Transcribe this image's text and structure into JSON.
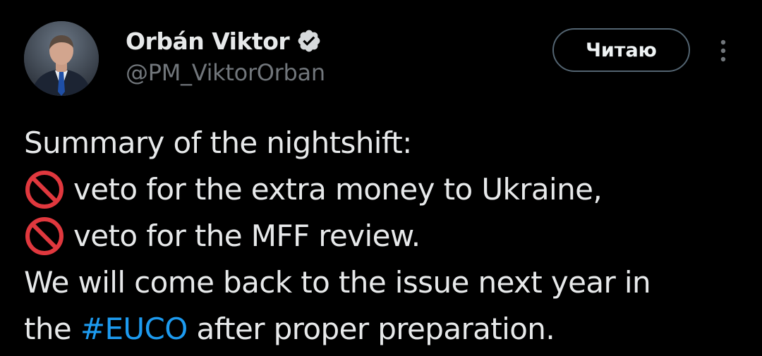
{
  "author": {
    "display_name": "Orbán Viktor",
    "handle": "@PM_ViktorOrban",
    "verified": true
  },
  "follow_button": {
    "label": "Читаю"
  },
  "more_button": {
    "icon": "more-vertical-icon"
  },
  "tweet": {
    "line1": "Summary of the nightshift:",
    "line2": "veto for the extra money to Ukraine,",
    "line3": "veto for the MFF review.",
    "line4": "We will come back to the issue next year in",
    "line5_before": "the ",
    "hashtag": "#EUCO",
    "line5_after": " after proper preparation.",
    "emoji_icon": "no-entry-sign-icon"
  },
  "colors": {
    "background": "#000000",
    "text": "#e7e9ea",
    "secondary_text": "#71767b",
    "link": "#1d9bf0",
    "button_border": "#536471"
  }
}
